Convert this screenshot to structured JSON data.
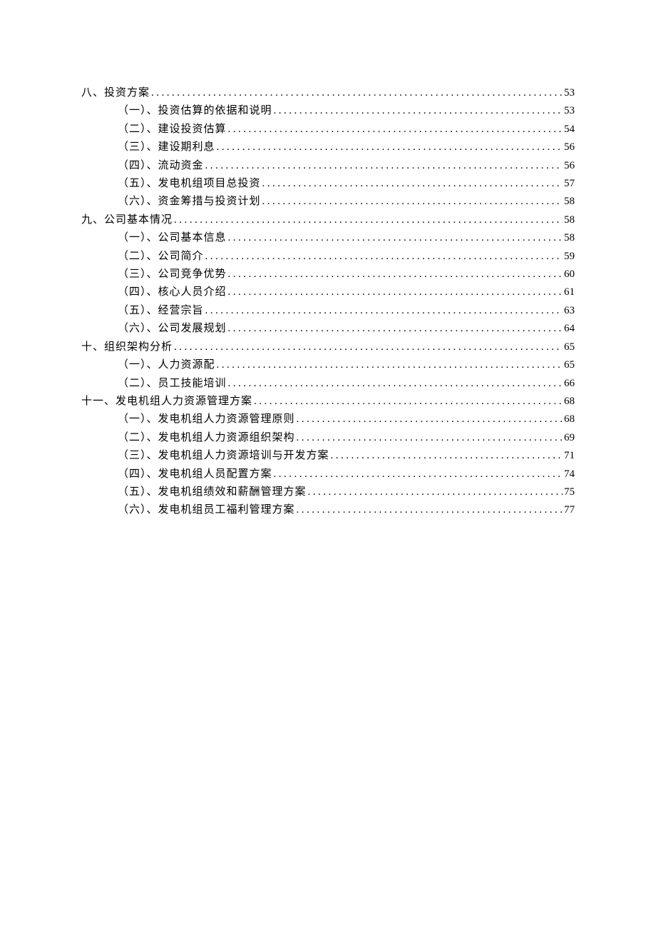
{
  "toc": [
    {
      "level": 1,
      "label": "八、投资方案",
      "page": "53"
    },
    {
      "level": 2,
      "label": "（一）、投资估算的依据和说明",
      "page": "53"
    },
    {
      "level": 2,
      "label": "（二）、建设投资估算",
      "page": "54"
    },
    {
      "level": 2,
      "label": "（三）、建设期利息",
      "page": "56"
    },
    {
      "level": 2,
      "label": "（四）、流动资金",
      "page": "56"
    },
    {
      "level": 2,
      "label": "（五）、发电机组项目总投资",
      "page": "57"
    },
    {
      "level": 2,
      "label": "（六）、资金筹措与投资计划",
      "page": "58"
    },
    {
      "level": 1,
      "label": "九、公司基本情况",
      "page": "58"
    },
    {
      "level": 2,
      "label": "（一）、公司基本信息",
      "page": "58"
    },
    {
      "level": 2,
      "label": "（二）、公司简介",
      "page": "59"
    },
    {
      "level": 2,
      "label": "（三）、公司竞争优势",
      "page": "60"
    },
    {
      "level": 2,
      "label": "（四）、核心人员介绍",
      "page": "61"
    },
    {
      "level": 2,
      "label": "（五）、经营宗旨",
      "page": "63"
    },
    {
      "level": 2,
      "label": "（六）、公司发展规划",
      "page": "64"
    },
    {
      "level": 1,
      "label": "十、组织架构分析",
      "page": "65"
    },
    {
      "level": 2,
      "label": "（一）、人力资源配",
      "page": "65"
    },
    {
      "level": 2,
      "label": "（二）、员工技能培训",
      "page": "66"
    },
    {
      "level": 1,
      "label": "十一、发电机组人力资源管理方案",
      "page": "68"
    },
    {
      "level": 2,
      "label": "（一）、发电机组人力资源管理原则",
      "page": "68"
    },
    {
      "level": 2,
      "label": "（二）、发电机组人力资源组织架构",
      "page": "69"
    },
    {
      "level": 2,
      "label": "（三）、发电机组人力资源培训与开发方案",
      "page": "71"
    },
    {
      "level": 2,
      "label": "（四）、发电机组人员配置方案",
      "page": "74"
    },
    {
      "level": 2,
      "label": "（五）、发电机组绩效和薪酬管理方案",
      "page": "75"
    },
    {
      "level": 2,
      "label": "（六）、发电机组员工福利管理方案",
      "page": "77"
    }
  ]
}
